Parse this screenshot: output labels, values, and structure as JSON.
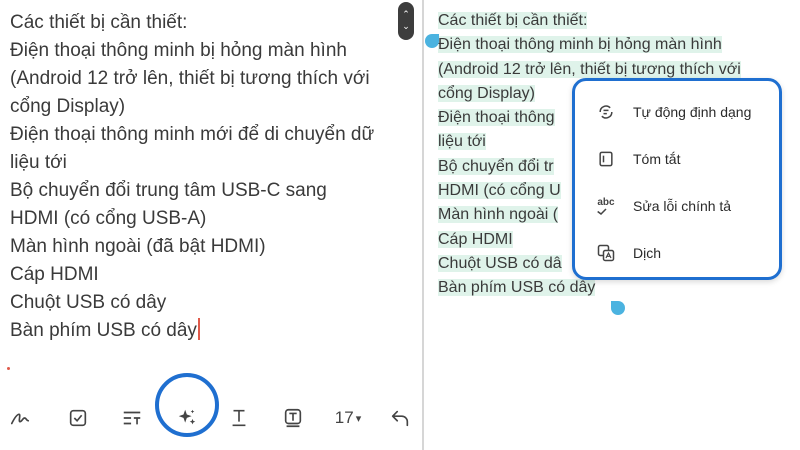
{
  "note_lines": [
    "Các thiết bị cần thiết:",
    "Điện thoại thông minh bị hỏng màn hình",
    "(Android 12 trở lên, thiết bị tương thích với",
    "cổng Display)",
    "Điện thoại thông minh mới để di chuyển dữ",
    "liệu tới",
    "Bộ chuyển đổi trung tâm USB-C sang",
    "HDMI (có cổng USB-A)",
    "Màn hình ngoài (đã bật HDMI)",
    "Cáp HDMI",
    "Chuột USB có dây",
    "Bàn phím USB có dây"
  ],
  "selected_lines": [
    "Các thiết bị cần thiết:",
    "Điện thoại thông minh bị hỏng màn hình",
    "(Android 12 trở lên, thiết bị tương thích với",
    "cổng Display)",
    "Điện thoại thông",
    "liệu tới",
    "Bộ chuyển đổi tr",
    "HDMI (có cổng U",
    "Màn hình ngoài (",
    "Cáp HDMI",
    "Chuột USB có dâ",
    "Bàn phím USB có dây"
  ],
  "toolbar": {
    "font_size": "17",
    "dropdown_arrow": "▾"
  },
  "scroll": {
    "up": "⌃",
    "down": "⌄"
  },
  "menu": {
    "items": [
      {
        "label": "Tự động định dạng",
        "icon": "auto-format-icon"
      },
      {
        "label": "Tóm tắt",
        "icon": "summarize-icon"
      },
      {
        "label": "Sửa lỗi chính tả",
        "icon": "spell-check-icon"
      },
      {
        "label": "Dịch",
        "icon": "translate-icon"
      }
    ],
    "spell_icon_text": "abc"
  },
  "colors": {
    "accent": "#1f6fd0",
    "selection": "#dff3ea",
    "handle": "#4bb3e0",
    "cursor": "#e05a4a"
  }
}
